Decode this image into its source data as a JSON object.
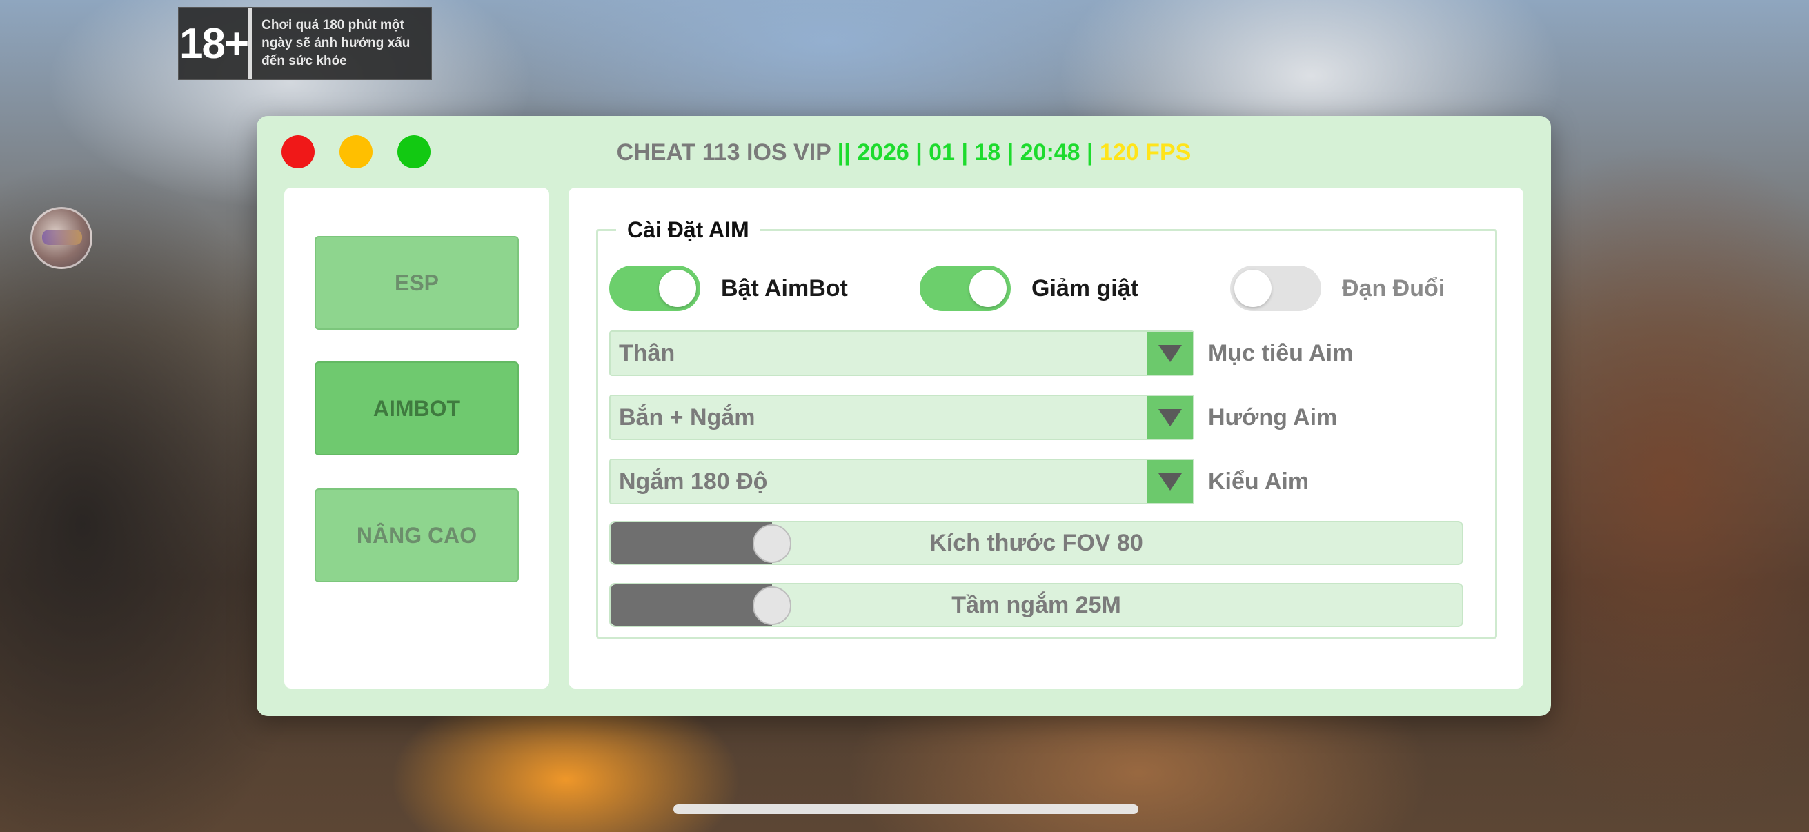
{
  "age_badge": {
    "rating": "18+",
    "warning": "Chơi quá 180 phút một ngày sẽ ảnh hưởng xấu đến sức khỏe"
  },
  "window": {
    "title_name": "CHEAT 113 IOS VIP",
    "title_info": " || 2026 | 01 | 18 | 20:48 | ",
    "title_fps": "120 FPS",
    "colors": {
      "background": "#d6f1d6",
      "accent": "#6cc96c",
      "close": "#f01818",
      "minimize": "#ffbf00",
      "maximize": "#12c912"
    }
  },
  "sidebar": {
    "items": [
      {
        "label": "ESP",
        "active": false
      },
      {
        "label": "AIMBOT",
        "active": true
      },
      {
        "label": "NÂNG CAO",
        "active": false
      }
    ]
  },
  "aim_settings": {
    "title": "Cài Đặt AIM",
    "toggles": [
      {
        "label": "Bật AimBot",
        "on": true
      },
      {
        "label": "Giảm giật",
        "on": true
      },
      {
        "label": "Đạn Đuổi",
        "on": false
      }
    ],
    "selects": [
      {
        "value": "Thân",
        "label": "Mục tiêu Aim"
      },
      {
        "value": "Bắn + Ngắm",
        "label": "Hướng Aim"
      },
      {
        "value": "Ngắm 180 Độ",
        "label": "Kiểu Aim"
      }
    ],
    "sliders": [
      {
        "text": "Kích thước FOV 80",
        "fraction": 0.19
      },
      {
        "text": "Tầm ngắm 25M",
        "fraction": 0.19
      }
    ]
  }
}
